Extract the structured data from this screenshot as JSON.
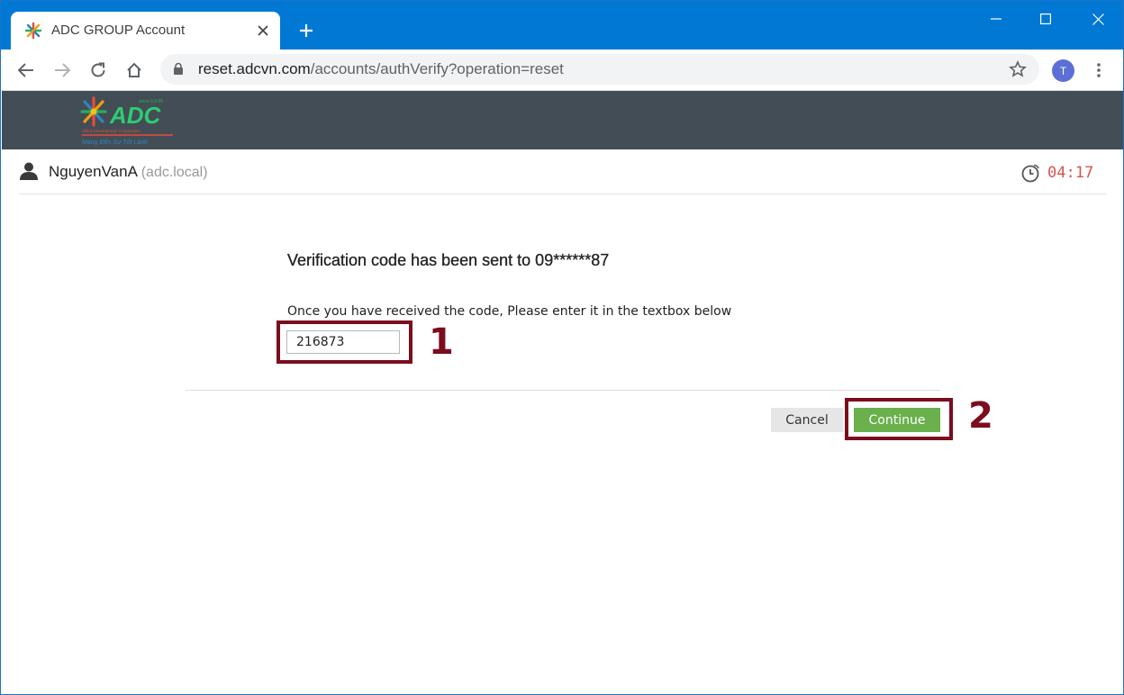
{
  "browser": {
    "tab_title": "ADC GROUP Account",
    "url_host": "reset.adcvn.com",
    "url_path": "/accounts/authVerify?operation=reset",
    "avatar_initial": "T"
  },
  "site": {
    "logo_text": "ADC",
    "logo_since": "since 9.9.99",
    "logo_tagline": "Allied Development Corporation",
    "logo_slogan": "Mang Đến Sự Tốt Lành"
  },
  "user": {
    "name": "NguyenVanA",
    "domain": "(adc.local)",
    "timer": "04:17"
  },
  "verify": {
    "heading": "Verification code has been sent to 09******87",
    "instruction": "Once you have received the code, Please enter it in the textbox below",
    "code_value": "216873"
  },
  "actions": {
    "cancel_label": "Cancel",
    "continue_label": "Continue"
  },
  "annotations": {
    "step1": "1",
    "step2": "2"
  },
  "colors": {
    "tabstrip": "#0078d4",
    "header": "#434d55",
    "highlight": "#7b0d1e",
    "continue": "#6ab04c",
    "timer": "#d9534f"
  }
}
